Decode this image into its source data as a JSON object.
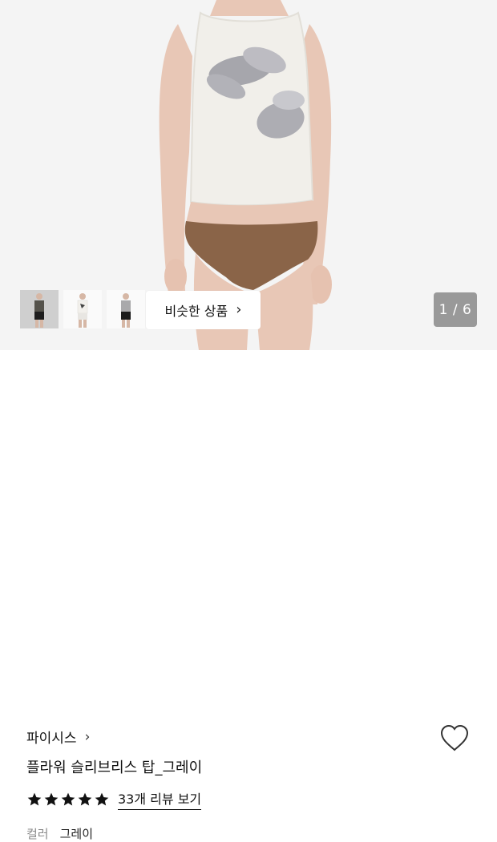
{
  "gallery": {
    "counter": "1 / 6",
    "similar_label": "비슷한 상품",
    "similar_chevron": "›",
    "thumbnails": [
      {
        "alt": "model-dark-top"
      },
      {
        "alt": "model-white-top"
      },
      {
        "alt": "model-gray-top"
      }
    ]
  },
  "product": {
    "brand": "파이시스",
    "brand_chevron": "›",
    "title": "플라워 슬리브리스 탑_그레이",
    "rating_stars": 5,
    "review_link": "33개 리뷰 보기",
    "option_label": "컬러",
    "option_value": "그레이"
  },
  "colors": {
    "hero_bg": "#f4f4f4",
    "counter_bg": "#999999",
    "star": "#111111"
  },
  "icons": {
    "wishlist": "heart-outline-icon",
    "star": "star-filled-icon"
  }
}
